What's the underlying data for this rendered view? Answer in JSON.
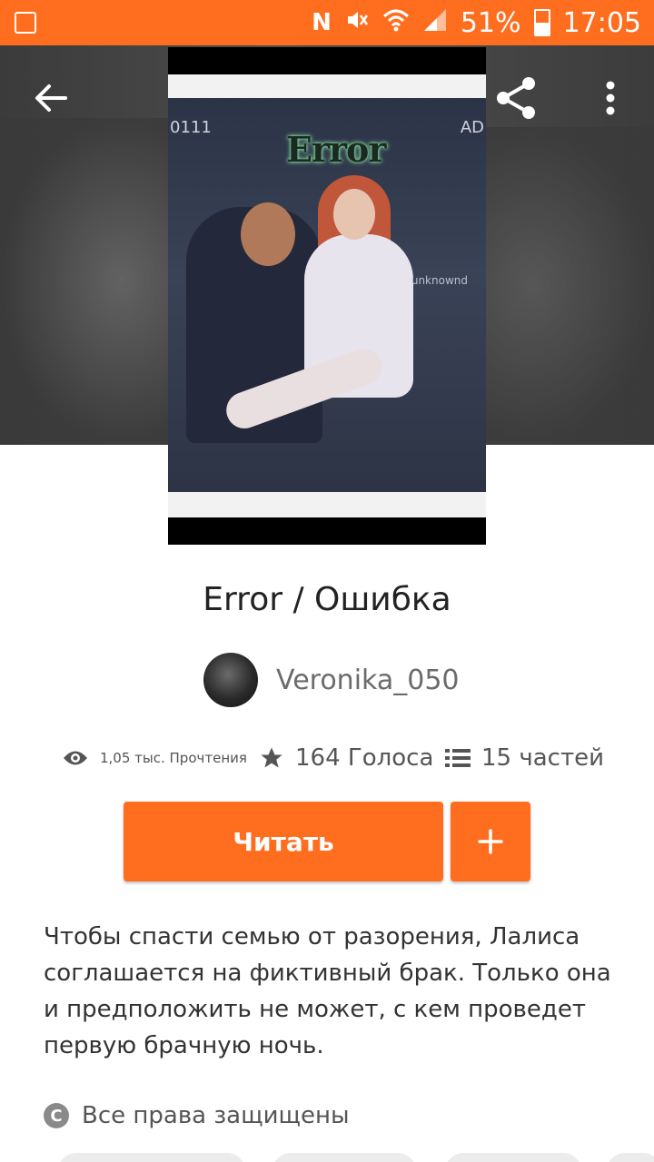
{
  "status_bar": {
    "battery": "51%",
    "time": "17:05",
    "icons": [
      "gallery-icon",
      "nfc-icon",
      "mute-icon",
      "wifi-icon",
      "signal-icon",
      "battery-icon"
    ]
  },
  "toolbar": {
    "back_icon": "arrow-left-icon",
    "share_icon": "share-icon",
    "more_icon": "more-vertical-icon"
  },
  "cover": {
    "art_title": "Error",
    "corner_left": "0111",
    "corner_right": "AD",
    "art_tag": "unknownd"
  },
  "story": {
    "title": "Error / Ошибка",
    "author": "Veronika_050",
    "reads": "1,05 тыс. Прочтения",
    "votes": "164 Голоса",
    "parts": "15 частей",
    "read_label": "Читать",
    "add_label": "+",
    "description": "Чтобы спасти семью от разорения, Лалиса соглашается на фиктивный брак. Только она и предположить не может, с кем проведет первую брачную ночь.",
    "rights": "Все права защищены",
    "copyright_symbol": "C"
  },
  "colors": {
    "accent": "#ff6d1f",
    "text": "#333333",
    "muted": "#555555"
  }
}
